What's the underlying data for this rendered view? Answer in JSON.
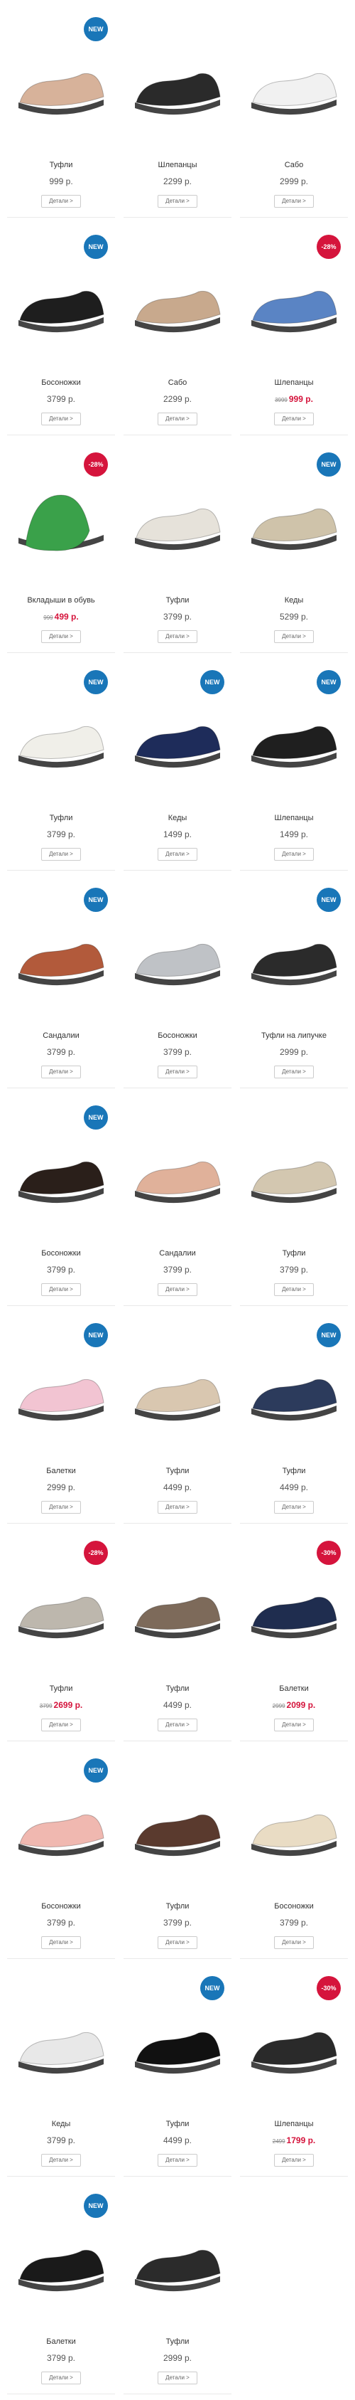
{
  "currency": "р.",
  "colors": {
    "badge_new": "#1976b8",
    "badge_sale": "#d5143c"
  },
  "products": [
    {
      "name": "Туфли",
      "price": "999",
      "badge": "NEW",
      "badge_type": "new",
      "icon": "beige-ballet-flat-icon",
      "shoe_color": "#d7b29a"
    },
    {
      "name": "Шлепанцы",
      "price": "2299",
      "icon": "black-slipper-icon",
      "shoe_color": "#2a2a2a"
    },
    {
      "name": "Сабо",
      "price": "2999",
      "icon": "white-clog-icon",
      "shoe_color": "#f1f1f1"
    },
    {
      "name": "Босоножки",
      "price": "3799",
      "badge": "NEW",
      "badge_type": "new",
      "icon": "black-sandal-icon",
      "shoe_color": "#1e1e1e"
    },
    {
      "name": "Сабо",
      "price": "2299",
      "icon": "beige-clog-icon",
      "shoe_color": "#c8a98d"
    },
    {
      "name": "Шлепанцы",
      "old_price": "3999",
      "price": "999",
      "badge": "-28%",
      "badge_type": "sale",
      "icon": "blue-slipper-icon",
      "shoe_color": "#5a84c4"
    },
    {
      "name": "Вкладыши в обувь",
      "old_price": "999",
      "price": "499",
      "badge": "-28%",
      "badge_type": "sale",
      "icon": "insole-icon",
      "shoe_color": "#3aa14a"
    },
    {
      "name": "Туфли",
      "price": "3799",
      "icon": "white-loafer-icon",
      "shoe_color": "#e6e2da"
    },
    {
      "name": "Кеды",
      "price": "5299",
      "badge": "NEW",
      "badge_type": "new",
      "icon": "beige-sneaker-icon",
      "shoe_color": "#cfc3aa"
    },
    {
      "name": "Туфли",
      "price": "3799",
      "badge": "NEW",
      "badge_type": "new",
      "icon": "white-flat-icon",
      "shoe_color": "#f0efe9"
    },
    {
      "name": "Кеды",
      "price": "1499",
      "badge": "NEW",
      "badge_type": "new",
      "icon": "navy-sneaker-icon",
      "shoe_color": "#1e2c5a"
    },
    {
      "name": "Шлепанцы",
      "price": "1499",
      "badge": "NEW",
      "badge_type": "new",
      "icon": "black-buckle-slipper-icon",
      "shoe_color": "#1f1f1f"
    },
    {
      "name": "Сандалии",
      "price": "3799",
      "badge": "NEW",
      "badge_type": "new",
      "icon": "multicolor-sandal-icon",
      "shoe_color": "#b25a3b"
    },
    {
      "name": "Босоножки",
      "price": "3799",
      "icon": "silver-sandal-icon",
      "shoe_color": "#bfc2c6"
    },
    {
      "name": "Туфли на липучке",
      "price": "2999",
      "badge": "NEW",
      "badge_type": "new",
      "icon": "black-velcro-sneaker-icon",
      "shoe_color": "#2b2b2b"
    },
    {
      "name": "Босоножки",
      "price": "3799",
      "badge": "NEW",
      "badge_type": "new",
      "icon": "black-heel-sandal-icon",
      "shoe_color": "#2a1f1a"
    },
    {
      "name": "Сандалии",
      "price": "3799",
      "icon": "beige-sandal-icon",
      "shoe_color": "#e0b19a"
    },
    {
      "name": "Туфли",
      "price": "3799",
      "icon": "beige-loafer-icon",
      "shoe_color": "#d3c7b0"
    },
    {
      "name": "Балетки",
      "price": "2999",
      "badge": "NEW",
      "badge_type": "new",
      "icon": "pink-ballet-flat-icon",
      "shoe_color": "#f2c4d2"
    },
    {
      "name": "Туфли",
      "price": "4499",
      "icon": "beige-perforated-flat-icon",
      "shoe_color": "#d9c7b0"
    },
    {
      "name": "Туфли",
      "price": "4499",
      "badge": "NEW",
      "badge_type": "new",
      "icon": "navy-flat-icon",
      "shoe_color": "#2c3b5c"
    },
    {
      "name": "Туфли",
      "old_price": "3799",
      "price": "2699",
      "badge": "-28%",
      "badge_type": "sale",
      "icon": "grey-slip-on-icon",
      "shoe_color": "#bdb7ad"
    },
    {
      "name": "Туфли",
      "price": "4499",
      "icon": "bronze-slip-on-icon",
      "shoe_color": "#7d6a5a"
    },
    {
      "name": "Балетки",
      "old_price": "2999",
      "price": "2099",
      "badge": "-30%",
      "badge_type": "sale",
      "icon": "navy-ballet-flat-icon",
      "shoe_color": "#1f2d4f"
    },
    {
      "name": "Босоножки",
      "price": "3799",
      "badge": "NEW",
      "badge_type": "new",
      "icon": "pink-sandal-icon",
      "shoe_color": "#f0b8b0"
    },
    {
      "name": "Туфли",
      "price": "3799",
      "icon": "brown-loafer-icon",
      "shoe_color": "#5a3a2e"
    },
    {
      "name": "Босоножки",
      "price": "3799",
      "icon": "beige-wedge-sandal-icon",
      "shoe_color": "#e9dcc4"
    },
    {
      "name": "Кеды",
      "price": "3799",
      "icon": "white-sneaker-icon",
      "shoe_color": "#e8e8e8"
    },
    {
      "name": "Туфли",
      "price": "4499",
      "badge": "NEW",
      "badge_type": "new",
      "icon": "black-loafer-icon",
      "shoe_color": "#111111"
    },
    {
      "name": "Шлепанцы",
      "old_price": "2499",
      "price": "1799",
      "badge": "-30%",
      "badge_type": "sale",
      "icon": "black-velcro-slipper-icon",
      "shoe_color": "#2a2a2a"
    },
    {
      "name": "Балетки",
      "price": "3799",
      "badge": "NEW",
      "badge_type": "new",
      "icon": "black-mary-jane-icon",
      "shoe_color": "#1a1a1a"
    },
    {
      "name": "Туфли",
      "price": "2999",
      "icon": "black-strap-flat-icon",
      "shoe_color": "#2b2b2b"
    }
  ],
  "details_label": "Детали >"
}
